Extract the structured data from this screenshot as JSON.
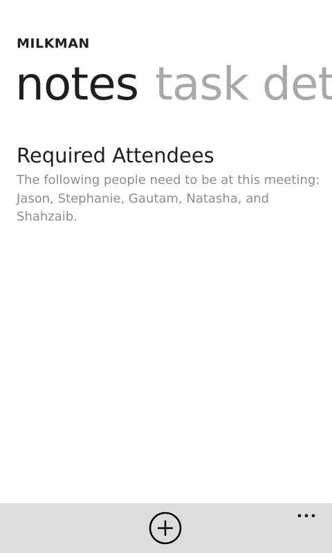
{
  "app": {
    "title": "MILKMAN"
  },
  "pivot": {
    "items": [
      {
        "label": "notes",
        "active": true
      },
      {
        "label": "task deta",
        "active": false
      }
    ]
  },
  "note": {
    "title": "Required Attendees",
    "body": "The following people need to be at this meeting: Jason, Stephanie, Gautam, Natasha, and Shahzaib."
  },
  "app_bar": {
    "background_color": "#dddddd",
    "icons": [
      "add-icon",
      "more-icon"
    ]
  }
}
